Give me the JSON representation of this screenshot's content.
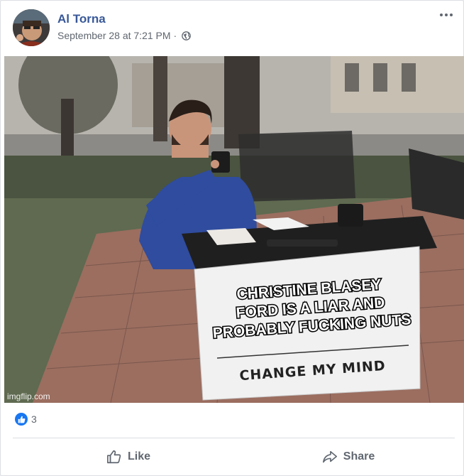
{
  "post": {
    "author": "Al Torna",
    "timestamp": "September 28 at 7:21 PM",
    "separator": "·",
    "privacy_icon": "globe-icon",
    "more_icon": "more-options-icon"
  },
  "image": {
    "meme_lines": [
      "CHRISTINE BLASEY",
      "FORD IS A LIAR AND",
      "PROBABLY FUCKING NUTS"
    ],
    "sign_text": "CHANGE MY MIND",
    "watermark": "imgflip.com"
  },
  "reactions": {
    "icon": "like-reaction-icon",
    "count": "3"
  },
  "actions": {
    "like_label": "Like",
    "share_label": "Share"
  },
  "colors": {
    "link": "#385898",
    "like_blue": "#1877f2",
    "secondary_text": "#606770"
  }
}
